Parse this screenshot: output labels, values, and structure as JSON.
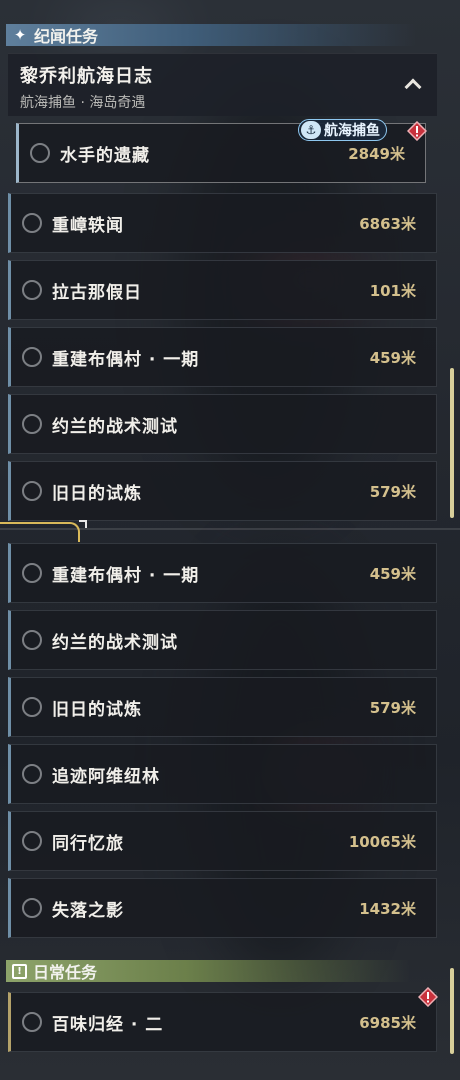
{
  "sections": {
    "quest_header": "纪闻任务",
    "daily_header": "日常任务"
  },
  "group": {
    "title": "黎乔利航海日志",
    "subtitle": "航海捕鱼 · 海岛奇遇"
  },
  "tag": {
    "label": "航海捕鱼",
    "icon": "anchor-icon"
  },
  "quests": [
    {
      "name": "水手的遗藏",
      "distance": "2849米"
    },
    {
      "name": "重嶂轶闻",
      "distance": "6863米"
    },
    {
      "name": "拉古那假日",
      "distance": "101米"
    },
    {
      "name": "重建布偶村 · 一期",
      "distance": "459米"
    },
    {
      "name": "约兰的战术测试",
      "distance": ""
    },
    {
      "name": "旧日的试炼",
      "distance": "579米"
    },
    {
      "name": "重建布偶村 · 一期",
      "distance": "459米"
    },
    {
      "name": "约兰的战术测试",
      "distance": ""
    },
    {
      "name": "旧日的试炼",
      "distance": "579米"
    },
    {
      "name": "追迹阿维纽林",
      "distance": ""
    },
    {
      "name": "同行忆旅",
      "distance": "10065米"
    },
    {
      "name": "失落之影",
      "distance": "1432米"
    }
  ],
  "daily_quests": [
    {
      "name": "百味归经 · 二",
      "distance": "6985米"
    }
  ],
  "colors": {
    "quest_accent": "#6f8fa7",
    "daily_accent": "#8da36a",
    "distance_text": "#d4c08d",
    "alert_red": "#c8323d"
  }
}
